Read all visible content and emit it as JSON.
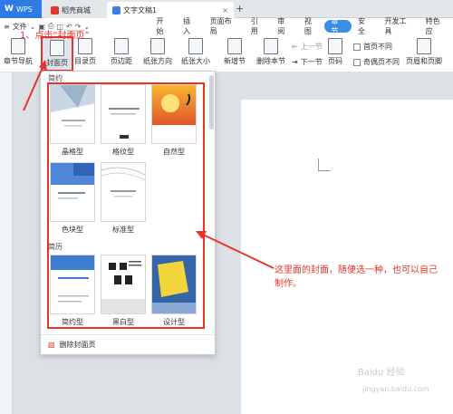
{
  "titlebar": {
    "app_label": "WPS",
    "tabs": [
      {
        "label": "稻壳商城"
      },
      {
        "label": "文字文稿1"
      }
    ],
    "new_tab": "+"
  },
  "menubar": {
    "file_label": "文件",
    "items": [
      "开始",
      "插入",
      "页面布局",
      "引用",
      "审阅",
      "视图",
      "章节",
      "安全",
      "开发工具",
      "特色应"
    ],
    "active": "章节"
  },
  "ribbon": {
    "chapter_nav": "章节导航",
    "cover": "封面页",
    "toc": "目录页",
    "margin": "页边距",
    "orientation": "纸张方向",
    "size": "纸张大小",
    "new_section": "新增节",
    "delete_section": "删除本节",
    "prev_section": "上一节",
    "next_section": "下一节",
    "page_number": "页码",
    "first_page_diff": "首页不同",
    "odd_even_diff": "奇偶页不同",
    "header_footer": "页眉和页脚"
  },
  "panel": {
    "section_jianyue": "简约",
    "section_jianli": "简历",
    "templates_row1": [
      "晶格型",
      "格纹型",
      "自然型"
    ],
    "templates_row2": [
      "色块型",
      "标准型"
    ],
    "templates_row3": [
      "简约型",
      "黑白型",
      "设计型"
    ],
    "delete_cover": "删除封面页"
  },
  "annotations": {
    "step1": "1、点击“封面页”",
    "tip": "这里面的封面，随便选一种，也可以自己制作。"
  },
  "watermark": {
    "line1": "Baidu 经验",
    "line2": "jingyan.baidu.com"
  },
  "colors": {
    "accent_blue": "#2f7be6",
    "annotation_red": "#e8332a"
  }
}
